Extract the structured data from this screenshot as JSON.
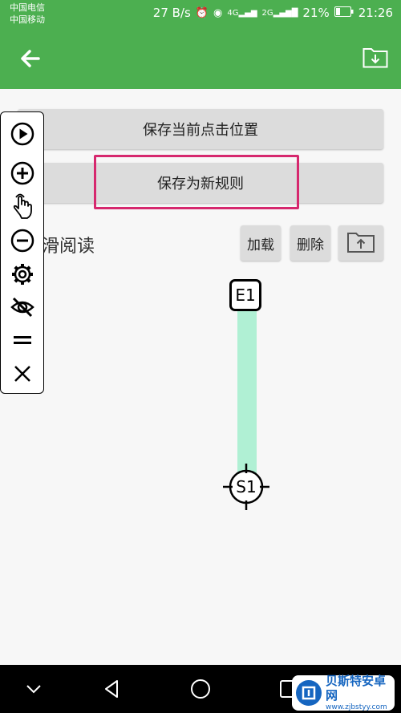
{
  "status_bar": {
    "carrier1": "中国电信",
    "carrier2": "中国移动",
    "speed": "27 B/s",
    "battery": "21%",
    "time": "21:26",
    "net1": "4G",
    "net2": "2G"
  },
  "app_bar": {
    "back_icon": "arrow-left-icon",
    "import_icon": "folder-download-icon"
  },
  "buttons": {
    "save_position": "保存当前点击位置",
    "save_rule": "保存为新规则",
    "load": "加载",
    "delete": "删除",
    "export_icon": "folder-upload-icon"
  },
  "rule_name": "上滑阅读",
  "markers": {
    "end": "E1",
    "start": "S1"
  },
  "float_panel": {
    "items": [
      "play-icon",
      "add-icon",
      "tap-gesture-icon",
      "remove-icon",
      "settings-icon",
      "hide-icon",
      "drag-handle-icon",
      "close-icon"
    ]
  },
  "watermark": {
    "title": "贝斯特安卓网",
    "url": "www.zjbstyy.com"
  },
  "colors": {
    "primary": "#4caf50",
    "highlight": "#d6286e",
    "swipe": "#b0f0d4"
  }
}
